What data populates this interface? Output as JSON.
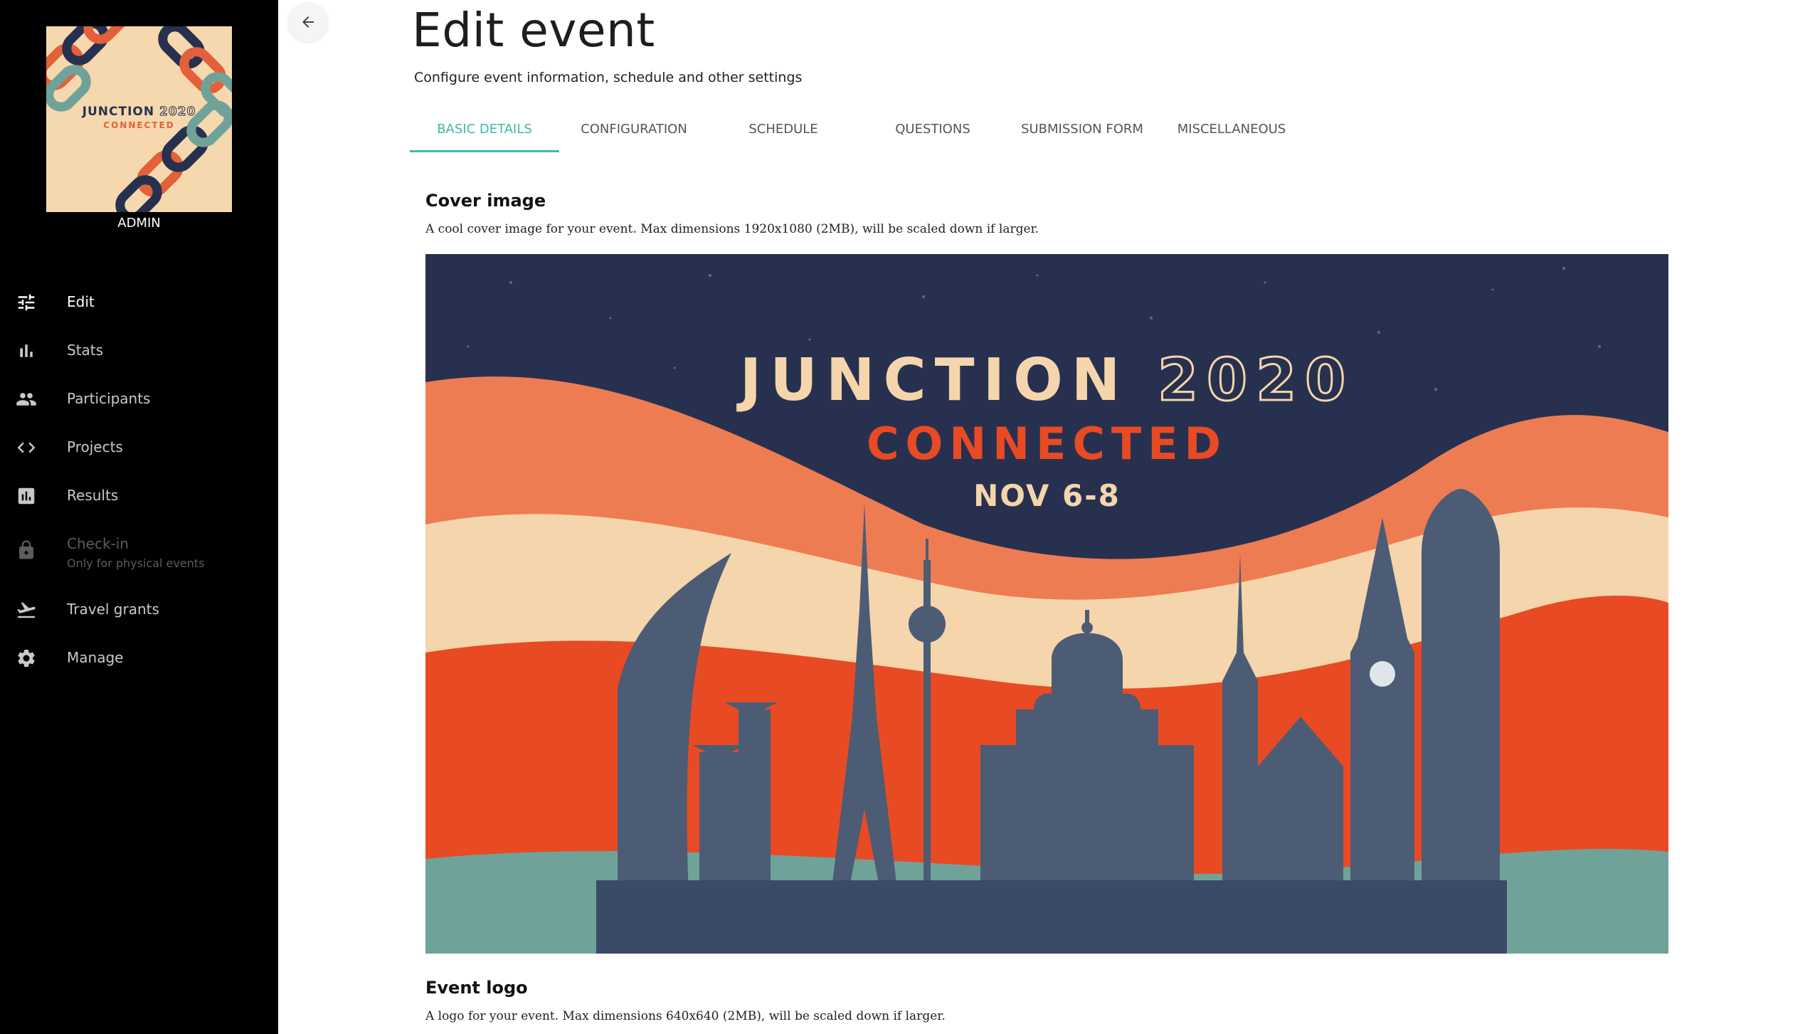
{
  "sidebar": {
    "logo": {
      "title": "JUNCTION",
      "year": "2020",
      "subtitle": "CONNECTED"
    },
    "role": "ADMIN",
    "items": [
      {
        "label": "Edit",
        "icon": "tune-icon",
        "active": true
      },
      {
        "label": "Stats",
        "icon": "bar-chart-icon"
      },
      {
        "label": "Participants",
        "icon": "people-icon"
      },
      {
        "label": "Projects",
        "icon": "code-icon"
      },
      {
        "label": "Results",
        "icon": "assessment-icon"
      },
      {
        "label": "Check-in",
        "sublabel": "Only for physical events",
        "icon": "lock-icon",
        "disabled": true
      },
      {
        "label": "Travel grants",
        "icon": "flight-takeoff-icon"
      },
      {
        "label": "Manage",
        "icon": "gear-icon"
      }
    ]
  },
  "header": {
    "back_icon": "arrow-back-icon",
    "title": "Edit event",
    "subtitle": "Configure event information, schedule and other settings"
  },
  "tabs": [
    {
      "label": "BASIC DETAILS",
      "active": true
    },
    {
      "label": "CONFIGURATION"
    },
    {
      "label": "SCHEDULE"
    },
    {
      "label": "QUESTIONS"
    },
    {
      "label": "SUBMISSION FORM"
    },
    {
      "label": "MISCELLANEOUS"
    }
  ],
  "cover_image": {
    "title": "Cover image",
    "description": "A cool cover image for your event. Max dimensions 1920x1080 (2MB), will be scaled down if larger.",
    "image_text": {
      "line1": "JUNCTION",
      "year": "2020",
      "line2": "CONNECTED",
      "line3": "NOV 6-8"
    }
  },
  "event_logo": {
    "title": "Event logo",
    "description": "A logo for your event. Max dimensions 640x640 (2MB), will be scaled down if larger."
  },
  "colors": {
    "accent": "#3fb9a4",
    "sidebar_bg": "#000000",
    "navy": "#27314f",
    "orange": "#e84a24",
    "peach": "#f5d5ab"
  }
}
